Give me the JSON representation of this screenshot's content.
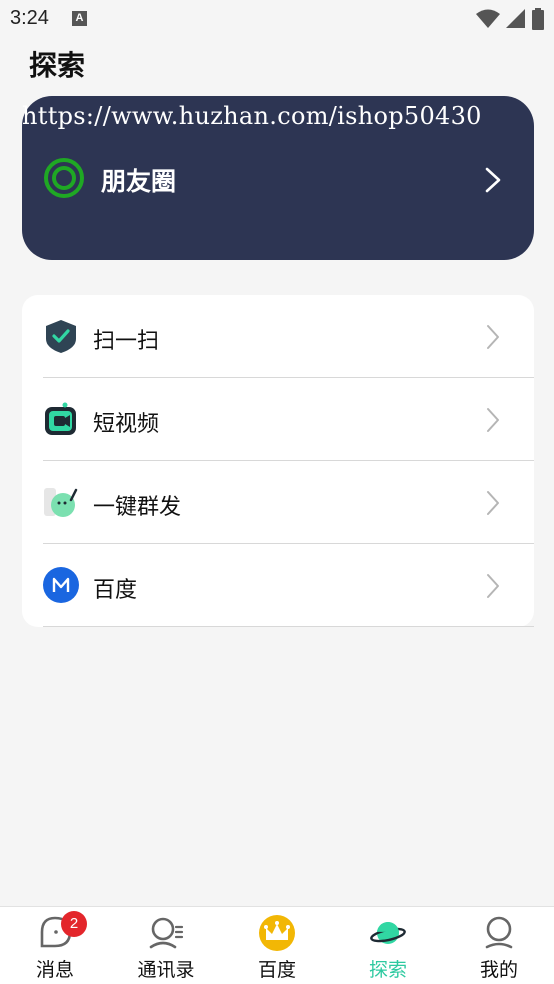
{
  "status_bar": {
    "time": "3:24",
    "notification_letter": "A",
    "icons": [
      "wifi-icon",
      "signal-icon",
      "battery-icon"
    ]
  },
  "page_title": "探索",
  "watermark": "https://www.huzhan.com/ishop50430",
  "moments": {
    "label": "朋友圈",
    "icon": "moments-ring-icon",
    "card_color": "#2d3553",
    "ring_color": "#1fa824"
  },
  "menu": {
    "items": [
      {
        "label": "扫一扫",
        "icon": "scan-shield-icon"
      },
      {
        "label": "短视频",
        "icon": "short-video-icon"
      },
      {
        "label": "一键群发",
        "icon": "mass-send-icon"
      },
      {
        "label": "百度",
        "icon": "baidu-m-icon"
      }
    ]
  },
  "tabs": {
    "items": [
      {
        "label": "消息",
        "icon": "message-bubble-icon",
        "badge": "2"
      },
      {
        "label": "通讯录",
        "icon": "contacts-icon"
      },
      {
        "label": "百度",
        "icon": "crown-icon"
      },
      {
        "label": "探索",
        "icon": "planet-icon",
        "active": true
      },
      {
        "label": "我的",
        "icon": "profile-icon"
      }
    ],
    "active_color": "#2ec9a0"
  }
}
